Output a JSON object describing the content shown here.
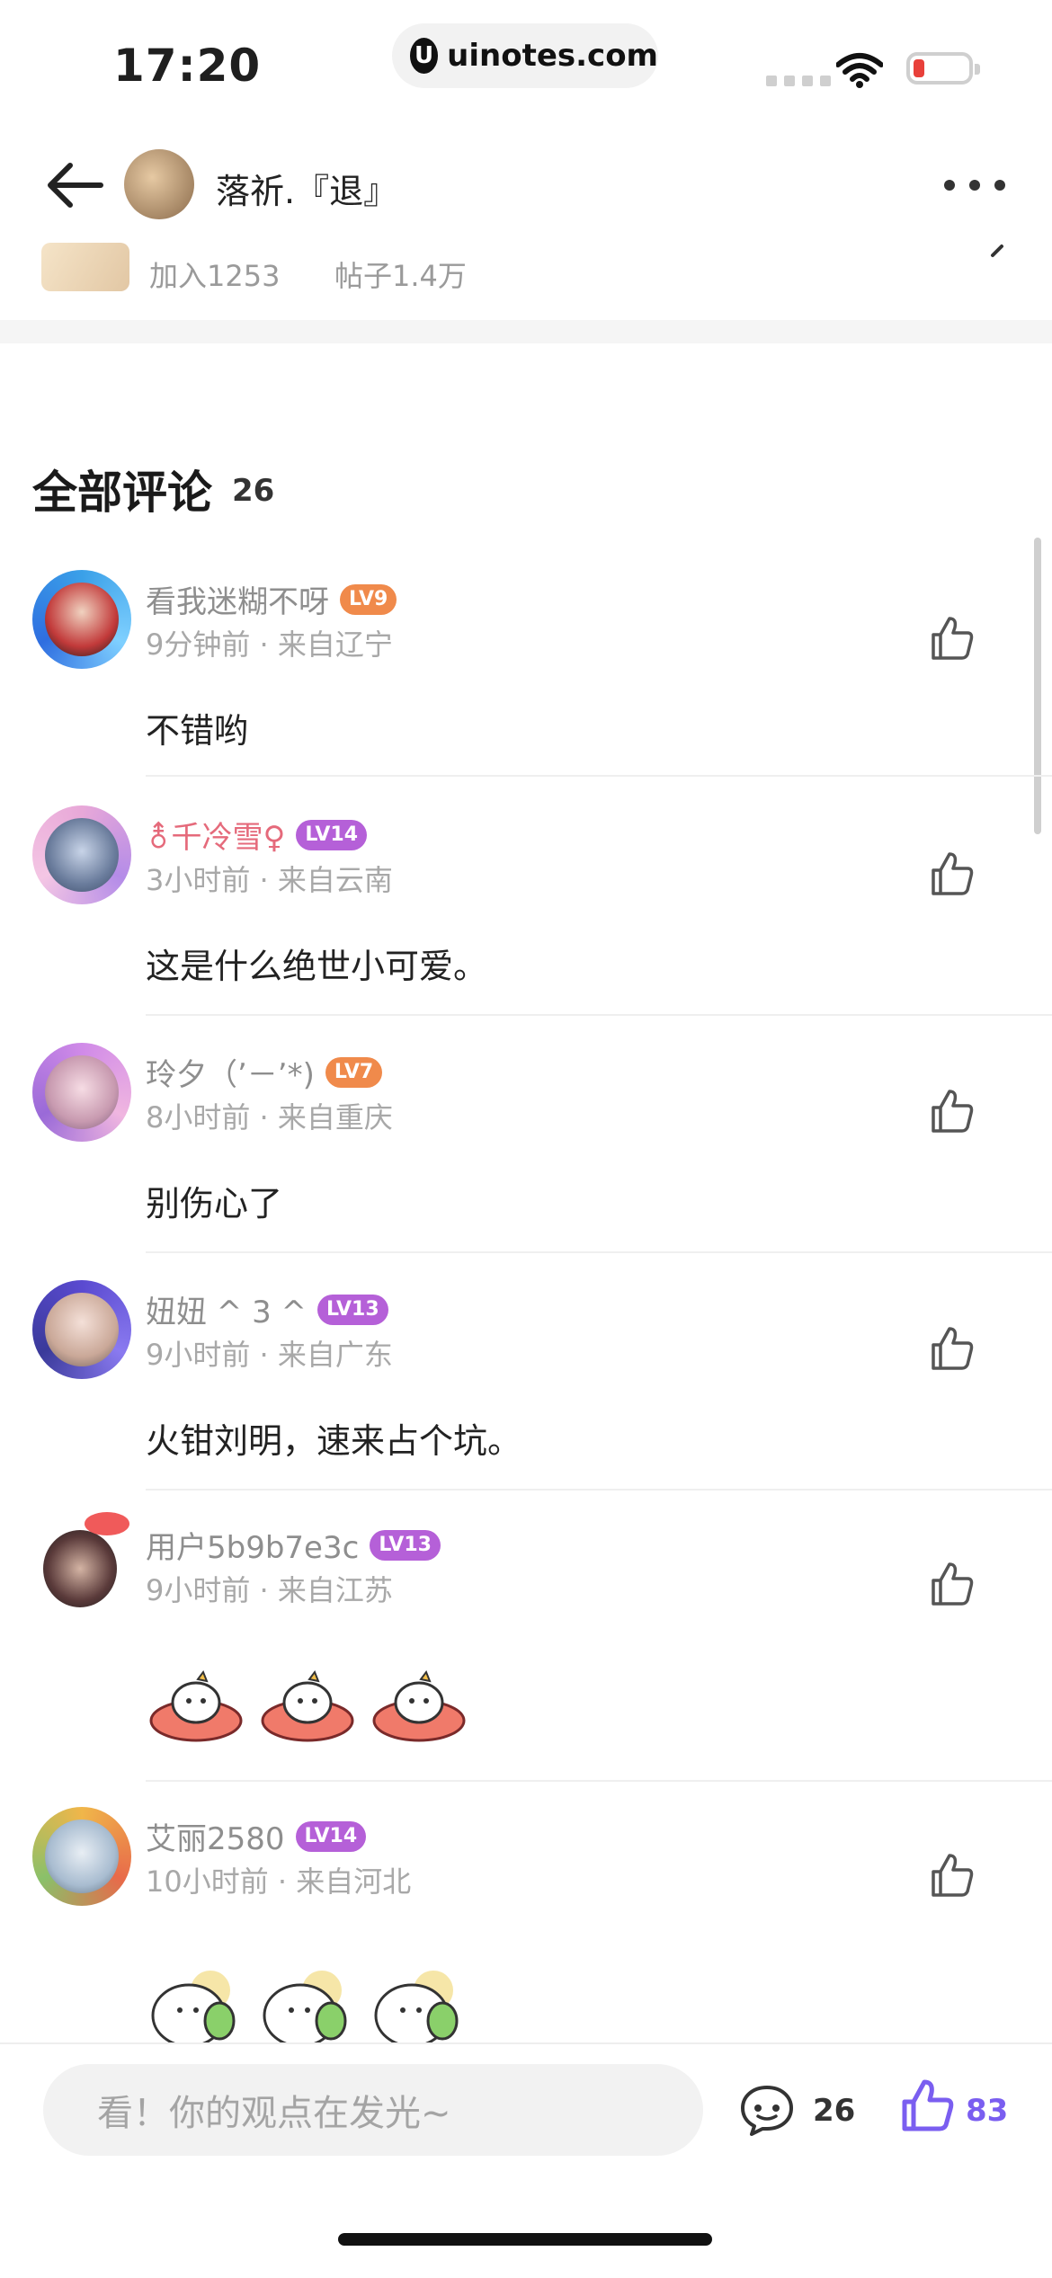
{
  "status_bar": {
    "time": "17:20",
    "url": "uinotes.com",
    "url_logo": "U"
  },
  "header": {
    "title": "落祈.『退』"
  },
  "forum": {
    "joined": "加入1253",
    "posts": "帖子1.4万"
  },
  "comments_section": {
    "title": "全部评论",
    "count": "26"
  },
  "comments": [
    {
      "name": "看我迷糊不呀",
      "level": "LV9",
      "time": "9分钟前 · 来自辽宁",
      "text": "不错哟"
    },
    {
      "name": "⚨千冷雪♀",
      "level": "LV14",
      "time": "3小时前 · 来自云南",
      "text": "这是什么绝世小可爱。"
    },
    {
      "name": "玲夕（’－’*)",
      "level": "LV7",
      "time": "8小时前 · 来自重庆",
      "text": "别伤心了"
    },
    {
      "name": "妞妞 ^ 3 ^",
      "level": "LV13",
      "time": "9小时前 · 来自广东",
      "text": "火钳刘明，速来占个坑。"
    },
    {
      "name": "用户5b9b7e3c",
      "level": "LV13",
      "time": "9小时前 · 来自江苏",
      "text": ""
    },
    {
      "name": "艾丽2580",
      "level": "LV14",
      "time": "10小时前 · 来自河北",
      "text": ""
    }
  ],
  "bottom_bar": {
    "placeholder": "看！你的观点在发光~",
    "comment_count": "26",
    "like_count": "83"
  },
  "colors": {
    "accent": "#7a5ef0",
    "lv_orange": "#f08a4b",
    "lv_purple": "#b560d8",
    "name_pink": "#e56a7b"
  }
}
